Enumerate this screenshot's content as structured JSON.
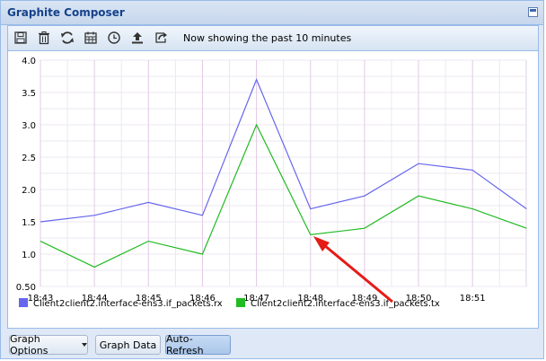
{
  "window": {
    "title": "Graphite Composer"
  },
  "toolbar": {
    "icons": [
      "save-icon",
      "trash-icon",
      "refresh-icon",
      "calendar-icon",
      "clock-icon",
      "upload-icon",
      "share-icon"
    ],
    "status_text": "Now showing the past 10 minutes"
  },
  "bottom": {
    "graph_options_label": "Graph Options",
    "graph_data_label": "Graph Data",
    "auto_refresh_label": "Auto-Refresh"
  },
  "annotation": {
    "color": "#e41b17"
  },
  "chart_data": {
    "type": "line",
    "x": [
      "18:43",
      "18:44",
      "18:45",
      "18:46",
      "18:47",
      "18:48",
      "18:49",
      "18:50",
      "18:51",
      "18:52"
    ],
    "x_tick_labels": [
      "18:43",
      "18:44",
      "18:45",
      "18:46",
      "18:47",
      "18:48",
      "18:49",
      "18:50",
      "18:51"
    ],
    "y_tick_labels": [
      "4.0",
      "3.5",
      "3.0",
      "2.5",
      "2.0",
      "1.5",
      "1.0",
      "0.50"
    ],
    "ylim": [
      0.5,
      4.0
    ],
    "grid": true,
    "legend_placement": "bottom-left",
    "series": [
      {
        "name": "Client2client2.interface-ens3.if_packets.rx",
        "color": "#6666ee",
        "values": [
          1.5,
          1.6,
          1.8,
          1.6,
          3.7,
          1.7,
          1.9,
          2.4,
          2.3,
          1.7
        ]
      },
      {
        "name": "Client2client2.interface-ens3.if_packets.tx",
        "color": "#22bb22",
        "values": [
          1.2,
          0.8,
          1.2,
          1.0,
          3.0,
          1.3,
          1.4,
          1.9,
          1.7,
          1.4
        ]
      }
    ]
  }
}
